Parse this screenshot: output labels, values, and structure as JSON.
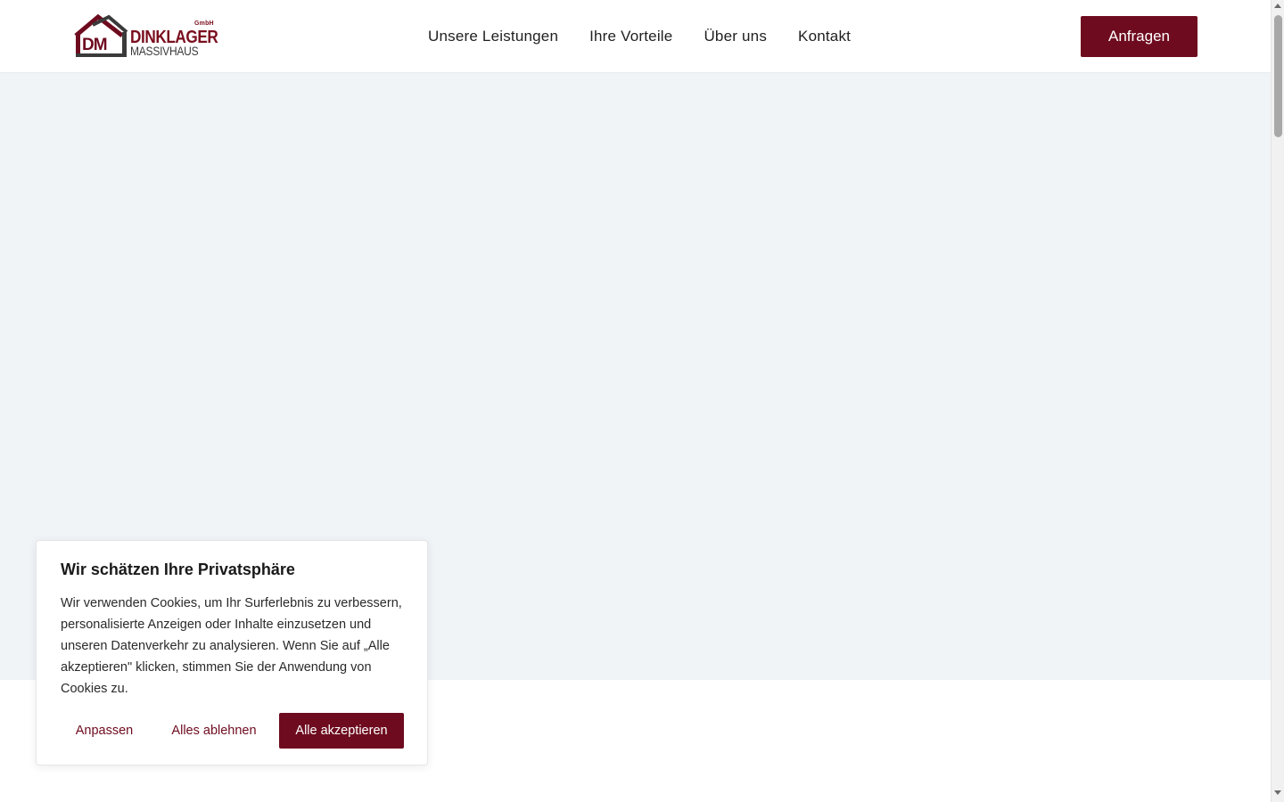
{
  "brand": {
    "name": "DINKLAGER",
    "subname": "MASSIVHAUS",
    "suffix": "GmbH",
    "monogram": "DM",
    "primary_color": "#6e0b1f"
  },
  "nav": {
    "items": [
      {
        "label": "Unsere Leistungen"
      },
      {
        "label": "Ihre Vorteile"
      },
      {
        "label": "Über uns"
      },
      {
        "label": "Kontakt"
      }
    ],
    "cta_label": "Anfragen"
  },
  "cookie": {
    "title": "Wir schätzen Ihre Privatsphäre",
    "text": "Wir verwenden Cookies, um Ihr Surferlebnis zu verbessern, personalisierte Anzeigen oder Inhalte einzusetzen und unseren Datenverkehr zu analysieren. Wenn Sie auf „Alle akzeptieren\" klicken, stimmen Sie der Anwendung von Cookies zu.",
    "customize_label": "Anpassen",
    "reject_label": "Alles ablehnen",
    "accept_label": "Alle akzeptieren"
  }
}
